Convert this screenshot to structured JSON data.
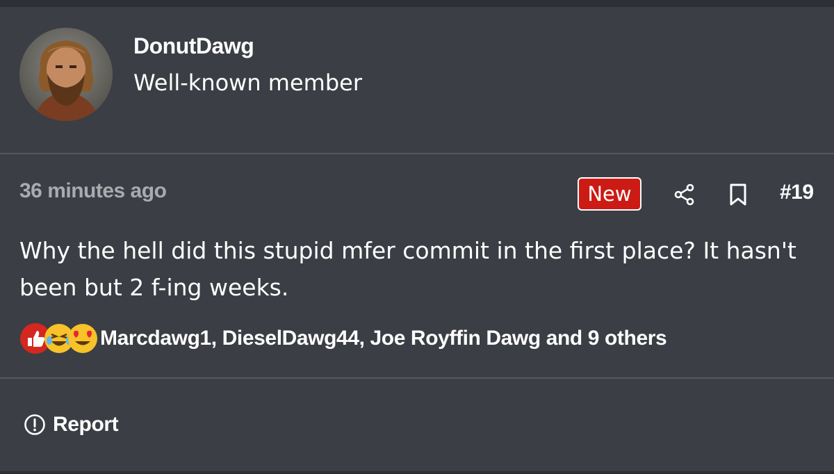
{
  "author": {
    "name": "DonutDawg",
    "title": "Well-known member"
  },
  "post": {
    "timestamp": "36 minutes ago",
    "badge": "New",
    "number": "#19",
    "body": "Why the hell did this stupid mfer commit in the first place? It hasn't been but 2 f-ing weeks."
  },
  "reactions": {
    "icons": [
      "like-icon",
      "laughing-crying-icon",
      "heart-eyes-icon"
    ],
    "users_text": "Marcdawg1, DieselDawg44, Joe Royffin Dawg and 9 others"
  },
  "actions": {
    "share_icon": "share-icon",
    "bookmark_icon": "bookmark-icon",
    "report_label": "Report"
  },
  "colors": {
    "background": "#3b3e44",
    "divider": "#55585e",
    "badge_red": "#cc1a14",
    "muted_text": "#a9abaf"
  }
}
